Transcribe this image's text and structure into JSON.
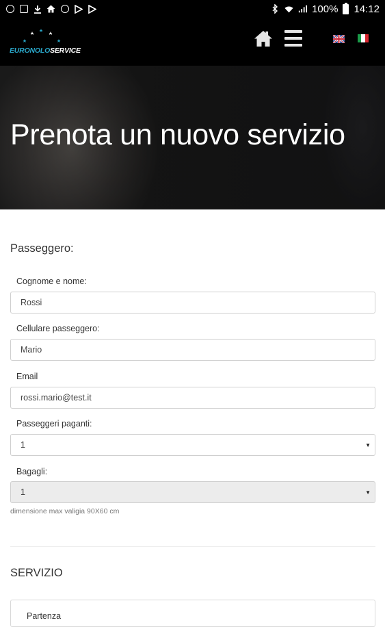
{
  "status_bar": {
    "battery": "100%",
    "time": "14:12",
    "left_icons": [
      "whatsapp-icon",
      "image-icon",
      "download-icon",
      "home-icon",
      "chrome-icon",
      "play-store-icon",
      "play-store-icon"
    ],
    "right_icons": [
      "bluetooth-icon",
      "wifi-icon",
      "signal-icon",
      "battery-icon"
    ]
  },
  "navbar": {
    "logo": {
      "part1": "EURONOLO",
      "part2": "SERVICE",
      "stars": 5
    },
    "home_icon": "home-icon",
    "menu_icon": "hamburger-menu-icon",
    "languages": [
      "English",
      "Italiano"
    ],
    "colors": {
      "background": "#000000",
      "accent": "#2aa7c9"
    }
  },
  "hero": {
    "title": "Prenota un nuovo servizio"
  },
  "form": {
    "section_passenger": "Passeggero:",
    "fields": {
      "name_label": "Cognome e nome:",
      "name_value": "Rossi",
      "mobile_label": "Cellulare passeggero:",
      "mobile_value": "Mario",
      "email_label": "Email",
      "email_value": "rossi.mario@test.it",
      "paying_label": "Passeggeri paganti:",
      "paying_value": "1",
      "luggage_label": "Bagagli:",
      "luggage_value": "1"
    },
    "luggage_help": "dimensione max valigia 90X60 cm",
    "section_service": "SERVIZIO",
    "departure_label": "Partenza"
  }
}
